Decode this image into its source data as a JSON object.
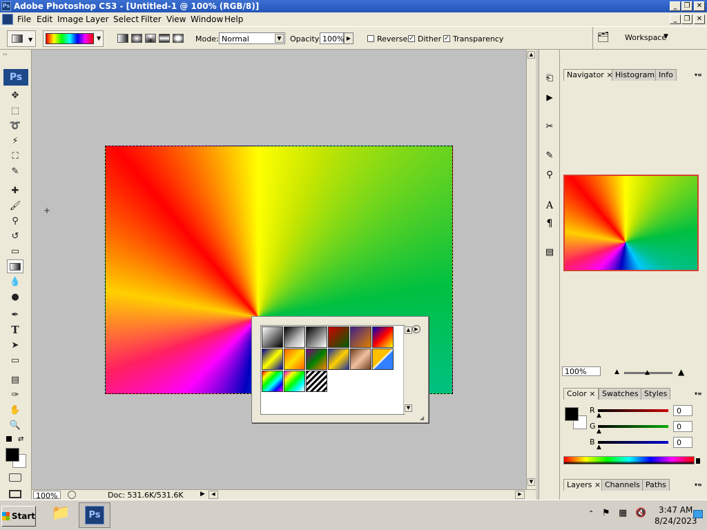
{
  "window": {
    "title": "Adobe Photoshop CS3 - [Untitled-1 @ 100% (RGB/8)]",
    "app_badge": "Ps"
  },
  "menubar": {
    "items": [
      "File",
      "Edit",
      "Image",
      "Layer",
      "Select",
      "Filter",
      "View",
      "Window",
      "Help"
    ]
  },
  "options_bar": {
    "mode_label": "Mode:",
    "mode_value": "Normal",
    "opacity_label": "Opacity:",
    "opacity_value": "100%",
    "reverse_label": "Reverse",
    "reverse_checked": false,
    "dither_label": "Dither",
    "dither_checked": true,
    "transparency_label": "Transparency",
    "transparency_checked": true,
    "workspace_label": "Workspace"
  },
  "toolbox": {
    "logo": "Ps",
    "foreground_color": "#000000",
    "background_color": "#ffffff"
  },
  "status_bar": {
    "zoom": "100%",
    "doc_info": "Doc: 531.6K/531.6K"
  },
  "gradient_picker": {
    "menu_icon": "arrow-right-circle-icon"
  },
  "panels": {
    "navigator_tabs": [
      "Navigator",
      "Histogram",
      "Info"
    ],
    "navigator_zoom": "100%",
    "color_tabs": [
      "Color",
      "Swatches",
      "Styles"
    ],
    "color_channels": [
      {
        "label": "R",
        "value": "0",
        "color": "#cc0000"
      },
      {
        "label": "G",
        "value": "0",
        "color": "#00aa00"
      },
      {
        "label": "B",
        "value": "0",
        "color": "#0000cc"
      }
    ],
    "layers_tabs": [
      "Layers",
      "Channels",
      "Paths"
    ]
  },
  "taskbar": {
    "start_label": "Start",
    "time": "3:47 AM",
    "date": "8/24/2023"
  }
}
